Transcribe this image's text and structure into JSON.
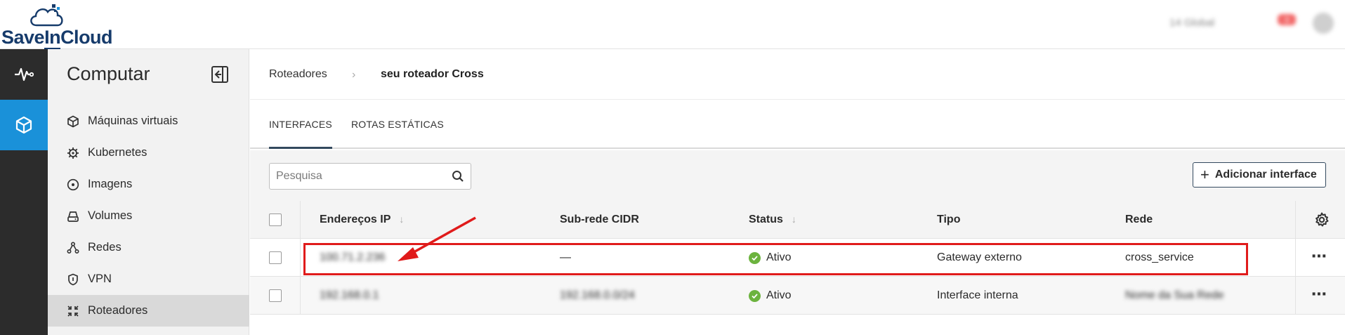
{
  "brand": {
    "name_part1": "Save",
    "name_part2": "In",
    "name_part3": "Cloud"
  },
  "header": {
    "user_label": "14 Global",
    "notif_count": "3"
  },
  "rail": {
    "items": [
      {
        "icon": "pulse-icon"
      },
      {
        "icon": "cube-icon",
        "active": true
      }
    ]
  },
  "sidebar": {
    "title": "Computar",
    "items": [
      {
        "label": "Máquinas virtuais",
        "icon": "cube-icon"
      },
      {
        "label": "Kubernetes",
        "icon": "helm-icon"
      },
      {
        "label": "Imagens",
        "icon": "disc-icon"
      },
      {
        "label": "Volumes",
        "icon": "drive-icon"
      },
      {
        "label": "Redes",
        "icon": "network-icon"
      },
      {
        "label": "VPN",
        "icon": "shield-icon"
      },
      {
        "label": "Roteadores",
        "icon": "router-icon",
        "active": true
      }
    ]
  },
  "breadcrumb": {
    "parent": "Roteadores",
    "separator": "›",
    "current": "seu roteador Cross"
  },
  "tabs": [
    {
      "label": "INTERFACES",
      "active": true
    },
    {
      "label": "ROTAS ESTÁTICAS"
    }
  ],
  "search": {
    "placeholder": "Pesquisa",
    "value": ""
  },
  "toolbar": {
    "add_label": "Adicionar interface"
  },
  "table": {
    "columns": [
      "Endereços IP",
      "Sub-rede CIDR",
      "Status",
      "Tipo",
      "Rede"
    ],
    "rows": [
      {
        "ip": "100.71.2.236",
        "cidr": "—",
        "status": "Ativo",
        "tipo": "Gateway externo",
        "rede": "cross_service"
      },
      {
        "ip": "192.168.0.1",
        "cidr": "192.168.0.0/24",
        "status": "Ativo",
        "tipo": "Interface interna",
        "rede": "Nome da Sua Rede"
      }
    ],
    "row_menu": "⋯"
  },
  "colors": {
    "accent": "#1a91d9",
    "rail_bg": "#2c2c2c",
    "highlight": "#e01b1b",
    "status_ok": "#6cb33e"
  }
}
